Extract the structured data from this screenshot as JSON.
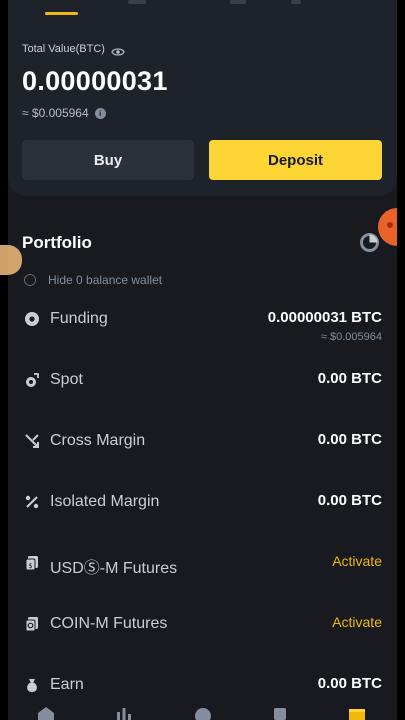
{
  "header": {
    "total_label": "Total Value(BTC)",
    "balance": "0.00000031",
    "usd_value": "≈ $0.005964"
  },
  "actions": {
    "buy_label": "Buy",
    "deposit_label": "Deposit"
  },
  "portfolio": {
    "title": "Portfolio",
    "hide_zero_label": "Hide 0 balance wallet",
    "accounts": [
      {
        "name": "Funding",
        "value": "0.00000031 BTC",
        "sub": "≈ $0.005964",
        "icon": "funding-icon"
      },
      {
        "name": "Spot",
        "value": "0.00 BTC",
        "icon": "spot-icon"
      },
      {
        "name": "Cross Margin",
        "value": "0.00 BTC",
        "icon": "cross-margin-icon"
      },
      {
        "name": "Isolated Margin",
        "value": "0.00 BTC",
        "icon": "isolated-margin-icon"
      },
      {
        "name": "USDⓈ-M Futures",
        "value": "Activate",
        "icon": "usds-futures-icon"
      },
      {
        "name": "COIN-M Futures",
        "value": "Activate",
        "icon": "coin-futures-icon"
      },
      {
        "name": "Earn",
        "value": "0.00 BTC",
        "icon": "earn-icon"
      }
    ]
  },
  "colors": {
    "accent": "#fcd535",
    "link": "#f0b90b",
    "background": "#181a20",
    "card": "#1e2329"
  }
}
